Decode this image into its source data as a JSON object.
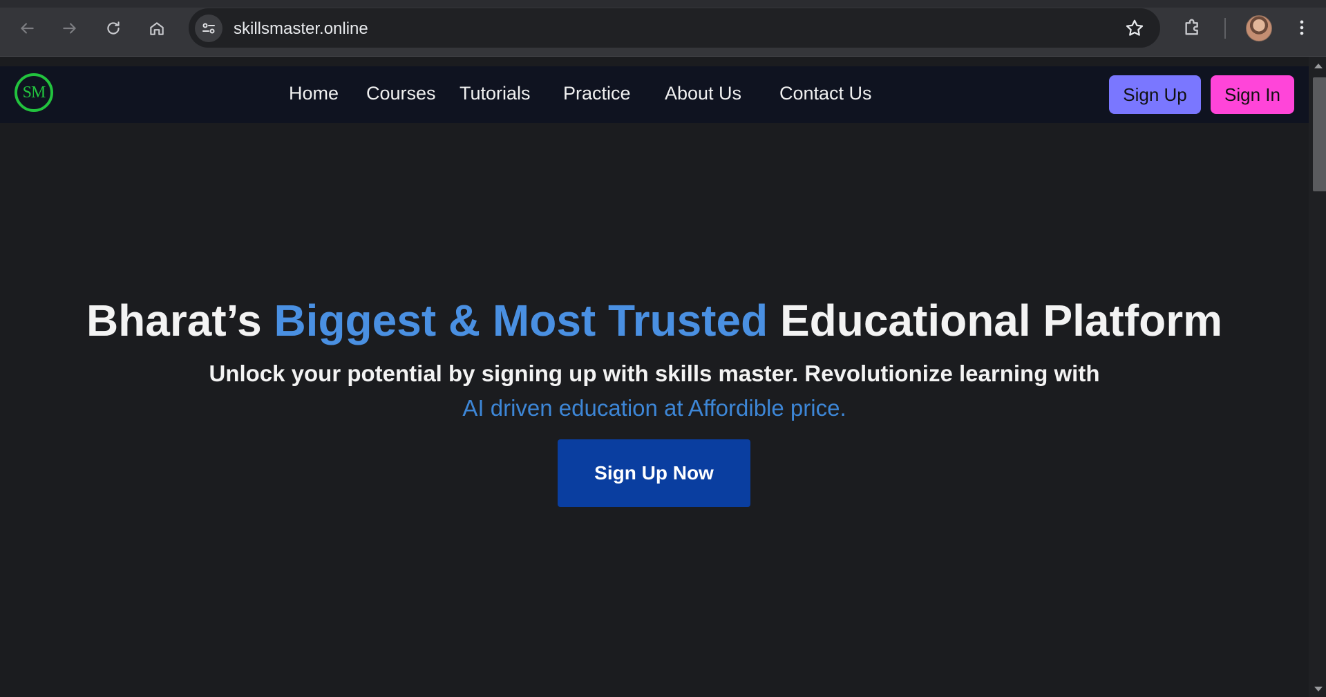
{
  "browser": {
    "url": "skillsmaster.online",
    "icons": {
      "back": "arrow-left-icon",
      "forward": "arrow-right-icon",
      "reload": "reload-icon",
      "home": "home-icon",
      "site_info": "tune-icon",
      "bookmark": "star-icon",
      "extensions": "puzzle-icon",
      "profile": "avatar",
      "menu": "kebab-menu-icon"
    }
  },
  "site": {
    "logo_text": "SM",
    "nav": {
      "links": [
        "Home",
        "Courses",
        "Tutorials",
        "Practice",
        "About Us",
        "Contact Us"
      ],
      "signup_label": "Sign Up",
      "signin_label": "Sign In"
    },
    "colors": {
      "navbar_bg": "#0f1320",
      "page_bg": "#1b1c1f",
      "logo_green": "#22c33e",
      "signup_bg": "#7a77ff",
      "signin_bg": "#ff45d9",
      "highlight_blue": "#4a90e2",
      "cta_bg": "#0a3ea0"
    }
  },
  "hero": {
    "title_part1": "Bharat’s ",
    "title_highlight": "Biggest & Most Trusted",
    "title_part2": " Educational Platform",
    "subtitle_line1": "Unlock your potential by signing up with skills master. Revolutionize learning with",
    "subtitle_line2": "AI driven education at Affordible price.",
    "cta_label": "Sign Up Now"
  }
}
